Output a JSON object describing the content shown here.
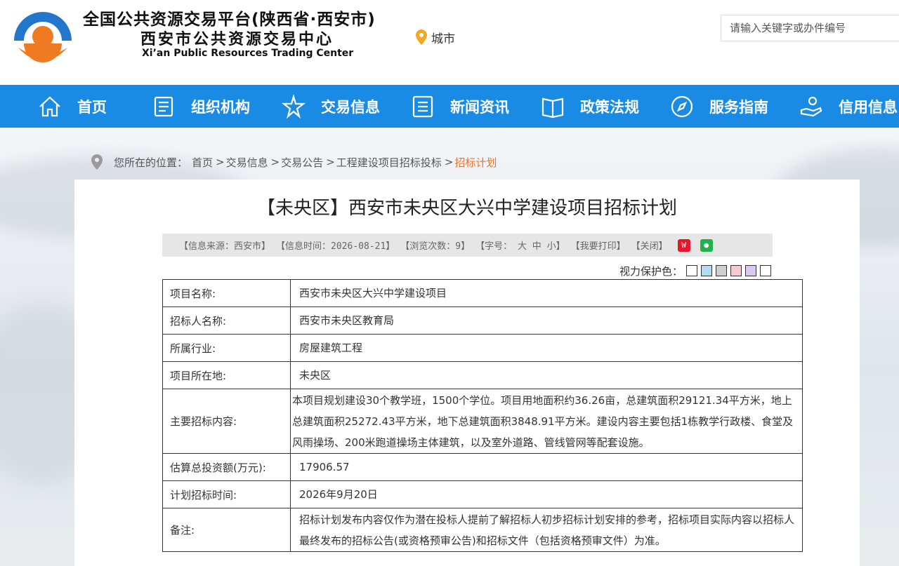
{
  "header": {
    "title_main": "全国公共资源交易平台(陕西省·西安市)",
    "title_sub": "西安市公共资源交易中心",
    "title_en": "Xi’an Public Resources Trading Center",
    "city_label": "城市",
    "search_placeholder": "请输入关键字或办件编号",
    "brand_colors": {
      "blue": "#2277cc",
      "orange": "#f07a22"
    }
  },
  "nav": {
    "items": [
      {
        "label": "首页",
        "icon": "home-icon"
      },
      {
        "label": "组织机构",
        "icon": "document-icon"
      },
      {
        "label": "交易信息",
        "icon": "star-icon"
      },
      {
        "label": "新闻资讯",
        "icon": "list-icon"
      },
      {
        "label": "政策法规",
        "icon": "book-icon"
      },
      {
        "label": "服务指南",
        "icon": "compass-icon"
      },
      {
        "label": "信用信息",
        "icon": "hand-icon"
      }
    ],
    "color": "#1a8be5"
  },
  "breadcrumb": {
    "prefix": "您所在的位置：",
    "items": [
      "首页",
      "交易信息",
      "交易公告",
      "工程建设项目招标投标",
      "招标计划"
    ]
  },
  "article": {
    "title": "【未央区】西安市未央区大兴中学建设项目招标计划",
    "meta": {
      "source": "【信息来源：西安市】",
      "time": "【信息时间：2026-08-21】",
      "views": "【浏览次数：9】",
      "font_size": "【字号： 大 中 小】",
      "print": "【我要打印】",
      "close": "【关闭】"
    },
    "eye_care_label": "视力保护色：",
    "eye_care_colors": [
      "#ffffff",
      "#b3dcf0",
      "#cfcfcf",
      "#f6c8cf",
      "#dcc8f0",
      "#ffffff"
    ]
  },
  "table": {
    "rows": [
      {
        "key": "项目名称:",
        "value": "西安市未央区大兴中学建设项目"
      },
      {
        "key": "招标人名称:",
        "value": "西安市未央区教育局"
      },
      {
        "key": "所属行业:",
        "value": "房屋建筑工程"
      },
      {
        "key": "项目所在地:",
        "value": "未央区"
      },
      {
        "key": "主要招标内容:",
        "value": "本项目规划建设30个教学班，1500个学位。项目用地面积约36.26亩，总建筑面积29121.34平方米，地上总建筑面积25272.43平方米，地下总建筑面积3848.91平方米。建设内容主要包括1栋教学行政楼、食堂及风雨操场、200米跑道操场主体建筑，以及室外道路、管线管网等配套设施。"
      },
      {
        "key": "估算总投资额(万元):",
        "value": "17906.57"
      },
      {
        "key": "计划招标时间:",
        "value": "2026年9月20日"
      },
      {
        "key": "备注:",
        "value": "招标计划发布内容仅作为潜在投标人提前了解招标人初步招标计划安排的参考，招标项目实际内容以招标人最终发布的招标公告(或资格预审公告)和招标文件（包括资格预审文件）为准。"
      }
    ]
  }
}
